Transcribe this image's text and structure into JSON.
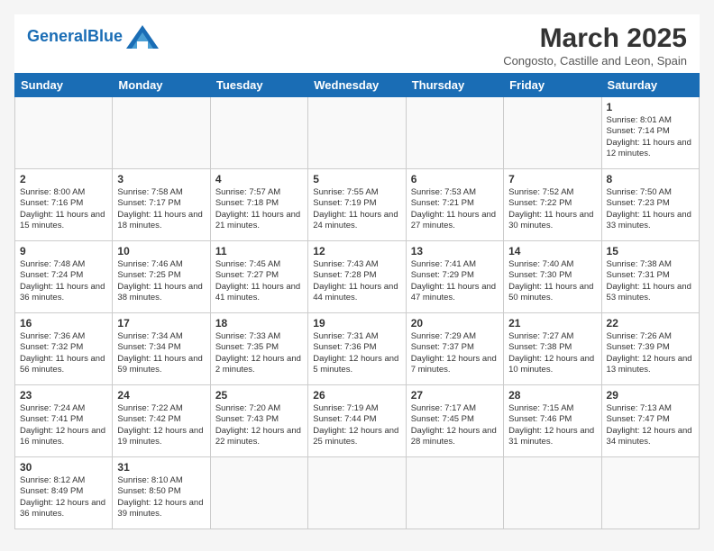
{
  "header": {
    "logo_general": "General",
    "logo_blue": "Blue",
    "month_title": "March 2025",
    "subtitle": "Congosto, Castille and Leon, Spain"
  },
  "days_of_week": [
    "Sunday",
    "Monday",
    "Tuesday",
    "Wednesday",
    "Thursday",
    "Friday",
    "Saturday"
  ],
  "weeks": [
    [
      {
        "day": "",
        "info": ""
      },
      {
        "day": "",
        "info": ""
      },
      {
        "day": "",
        "info": ""
      },
      {
        "day": "",
        "info": ""
      },
      {
        "day": "",
        "info": ""
      },
      {
        "day": "",
        "info": ""
      },
      {
        "day": "1",
        "info": "Sunrise: 8:01 AM\nSunset: 7:14 PM\nDaylight: 11 hours and 12 minutes."
      }
    ],
    [
      {
        "day": "2",
        "info": "Sunrise: 8:00 AM\nSunset: 7:16 PM\nDaylight: 11 hours and 15 minutes."
      },
      {
        "day": "3",
        "info": "Sunrise: 7:58 AM\nSunset: 7:17 PM\nDaylight: 11 hours and 18 minutes."
      },
      {
        "day": "4",
        "info": "Sunrise: 7:57 AM\nSunset: 7:18 PM\nDaylight: 11 hours and 21 minutes."
      },
      {
        "day": "5",
        "info": "Sunrise: 7:55 AM\nSunset: 7:19 PM\nDaylight: 11 hours and 24 minutes."
      },
      {
        "day": "6",
        "info": "Sunrise: 7:53 AM\nSunset: 7:21 PM\nDaylight: 11 hours and 27 minutes."
      },
      {
        "day": "7",
        "info": "Sunrise: 7:52 AM\nSunset: 7:22 PM\nDaylight: 11 hours and 30 minutes."
      },
      {
        "day": "8",
        "info": "Sunrise: 7:50 AM\nSunset: 7:23 PM\nDaylight: 11 hours and 33 minutes."
      }
    ],
    [
      {
        "day": "9",
        "info": "Sunrise: 7:48 AM\nSunset: 7:24 PM\nDaylight: 11 hours and 36 minutes."
      },
      {
        "day": "10",
        "info": "Sunrise: 7:46 AM\nSunset: 7:25 PM\nDaylight: 11 hours and 38 minutes."
      },
      {
        "day": "11",
        "info": "Sunrise: 7:45 AM\nSunset: 7:27 PM\nDaylight: 11 hours and 41 minutes."
      },
      {
        "day": "12",
        "info": "Sunrise: 7:43 AM\nSunset: 7:28 PM\nDaylight: 11 hours and 44 minutes."
      },
      {
        "day": "13",
        "info": "Sunrise: 7:41 AM\nSunset: 7:29 PM\nDaylight: 11 hours and 47 minutes."
      },
      {
        "day": "14",
        "info": "Sunrise: 7:40 AM\nSunset: 7:30 PM\nDaylight: 11 hours and 50 minutes."
      },
      {
        "day": "15",
        "info": "Sunrise: 7:38 AM\nSunset: 7:31 PM\nDaylight: 11 hours and 53 minutes."
      }
    ],
    [
      {
        "day": "16",
        "info": "Sunrise: 7:36 AM\nSunset: 7:32 PM\nDaylight: 11 hours and 56 minutes."
      },
      {
        "day": "17",
        "info": "Sunrise: 7:34 AM\nSunset: 7:34 PM\nDaylight: 11 hours and 59 minutes."
      },
      {
        "day": "18",
        "info": "Sunrise: 7:33 AM\nSunset: 7:35 PM\nDaylight: 12 hours and 2 minutes."
      },
      {
        "day": "19",
        "info": "Sunrise: 7:31 AM\nSunset: 7:36 PM\nDaylight: 12 hours and 5 minutes."
      },
      {
        "day": "20",
        "info": "Sunrise: 7:29 AM\nSunset: 7:37 PM\nDaylight: 12 hours and 7 minutes."
      },
      {
        "day": "21",
        "info": "Sunrise: 7:27 AM\nSunset: 7:38 PM\nDaylight: 12 hours and 10 minutes."
      },
      {
        "day": "22",
        "info": "Sunrise: 7:26 AM\nSunset: 7:39 PM\nDaylight: 12 hours and 13 minutes."
      }
    ],
    [
      {
        "day": "23",
        "info": "Sunrise: 7:24 AM\nSunset: 7:41 PM\nDaylight: 12 hours and 16 minutes."
      },
      {
        "day": "24",
        "info": "Sunrise: 7:22 AM\nSunset: 7:42 PM\nDaylight: 12 hours and 19 minutes."
      },
      {
        "day": "25",
        "info": "Sunrise: 7:20 AM\nSunset: 7:43 PM\nDaylight: 12 hours and 22 minutes."
      },
      {
        "day": "26",
        "info": "Sunrise: 7:19 AM\nSunset: 7:44 PM\nDaylight: 12 hours and 25 minutes."
      },
      {
        "day": "27",
        "info": "Sunrise: 7:17 AM\nSunset: 7:45 PM\nDaylight: 12 hours and 28 minutes."
      },
      {
        "day": "28",
        "info": "Sunrise: 7:15 AM\nSunset: 7:46 PM\nDaylight: 12 hours and 31 minutes."
      },
      {
        "day": "29",
        "info": "Sunrise: 7:13 AM\nSunset: 7:47 PM\nDaylight: 12 hours and 34 minutes."
      }
    ],
    [
      {
        "day": "30",
        "info": "Sunrise: 8:12 AM\nSunset: 8:49 PM\nDaylight: 12 hours and 36 minutes."
      },
      {
        "day": "31",
        "info": "Sunrise: 8:10 AM\nSunset: 8:50 PM\nDaylight: 12 hours and 39 minutes."
      },
      {
        "day": "",
        "info": ""
      },
      {
        "day": "",
        "info": ""
      },
      {
        "day": "",
        "info": ""
      },
      {
        "day": "",
        "info": ""
      },
      {
        "day": "",
        "info": ""
      }
    ]
  ]
}
